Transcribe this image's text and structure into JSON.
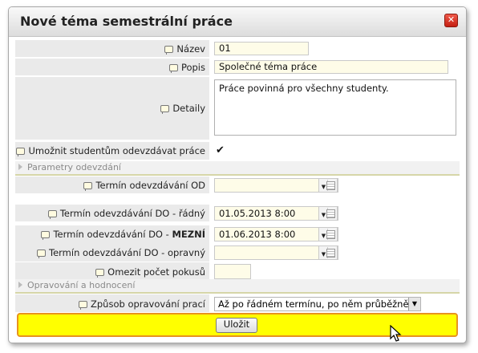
{
  "dialog": {
    "title": "Nové téma semestrální práce",
    "close_icon": "close-icon"
  },
  "fields": {
    "nazev": {
      "label": "Název",
      "value": "01"
    },
    "popis": {
      "label": "Popis",
      "value": "Společné téma práce"
    },
    "detaily": {
      "label": "Detaily",
      "value": "Práce povinná pro všechny studenty."
    },
    "umoznit": {
      "label": "Umožnit studentům odevzdávat práce",
      "checked": true,
      "mark": "✔"
    }
  },
  "sections": {
    "parametry": "Parametry odevzdání",
    "opravovani": "Opravování a hodnocení"
  },
  "dates": {
    "od": {
      "label": "Termín odevzdávání OD",
      "value": ""
    },
    "do_radny": {
      "label": "Termín odevzdávání DO - řádný",
      "value": "01.05.2013 8:00"
    },
    "do_mezni_prefix": "Termín odevzdávání DO - ",
    "do_mezni_bold": "MEZNÍ",
    "do_mezni_value": "01.06.2013 8:00",
    "do_opravny": {
      "label": "Termín odevzdávání DO - opravný",
      "value": ""
    }
  },
  "pokusy": {
    "label": "Omezit počet pokusů",
    "value": ""
  },
  "zpusob": {
    "label": "Způsob opravování prací",
    "value": "Až po řádném termínu, po něm průběžně"
  },
  "footer": {
    "save_label": "Uložit"
  }
}
